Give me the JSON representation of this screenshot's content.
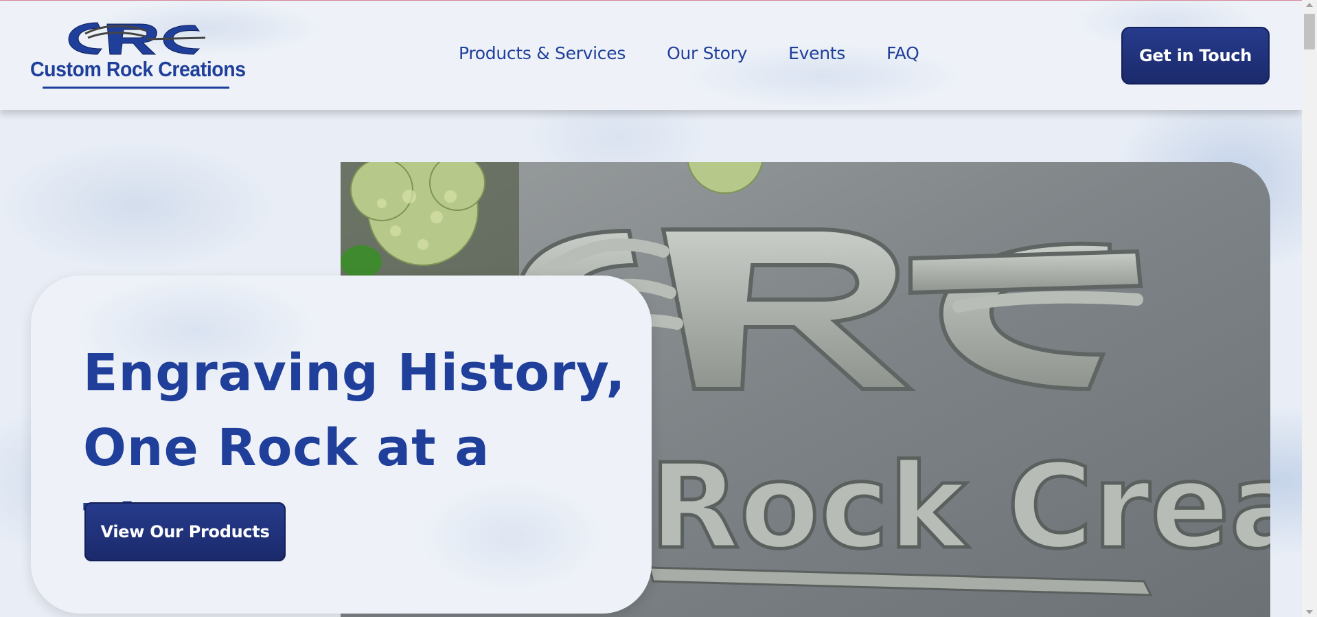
{
  "brand": {
    "mark": "CRC",
    "name": "Custom Rock Creations"
  },
  "nav": {
    "items": [
      {
        "label": "Products & Services"
      },
      {
        "label": "Our Story"
      },
      {
        "label": "Events"
      },
      {
        "label": "FAQ"
      }
    ],
    "cta_label": "Get in Touch"
  },
  "hero": {
    "title_line1": "Engraving History,",
    "title_line2": "One Rock at a Time",
    "button_label": "View Our Products",
    "photo": {
      "description_icon": "engraved-stone-sign-image",
      "engraved_text": "Rock Creations"
    }
  },
  "colors": {
    "brand_blue": "#1f3f9a",
    "button_navy": "#1b2a6b",
    "background": "#e9eef6"
  }
}
